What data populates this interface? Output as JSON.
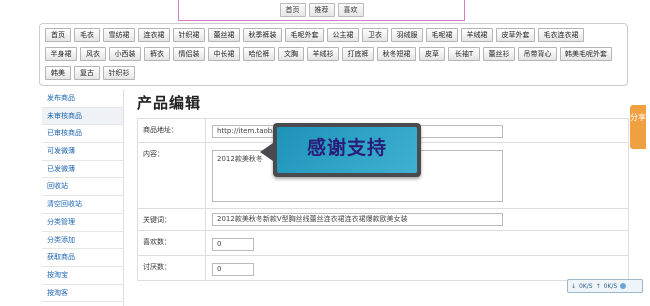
{
  "top_nav": {
    "items": [
      "首页",
      "推荐",
      "喜欢"
    ]
  },
  "categories": [
    "首页",
    "毛衣",
    "雪纺裙",
    "连衣裙",
    "针织裙",
    "蕾丝裙",
    "秋季裤装",
    "毛呢外套",
    "公主裙",
    "卫衣",
    "羽绒服",
    "毛呢裙",
    "羊绒裙",
    "皮草外套",
    "毛衣连衣裙",
    "半身裙",
    "风衣",
    "小西装",
    "裤衣",
    "情侣装",
    "中长裙",
    "哈伦裤",
    "文胸",
    "羊绒衫",
    "打底裤",
    "秋冬短裙",
    "皮草",
    "长袖T",
    "蕾丝衫",
    "吊带背心",
    "韩美毛呢外套",
    "韩美",
    "复古",
    "针织衫"
  ],
  "sidebar": {
    "items": [
      "发布商品",
      "未审核商品",
      "已审核商品",
      "可发微薄",
      "已发微薄",
      "回收站",
      "清空回收站",
      "分类管理",
      "分类添加",
      "获取商品",
      "按淘宝",
      "按淘客"
    ]
  },
  "page_title": "产品编辑",
  "form": {
    "url_label": "商品地址：",
    "url_value": "http://item.taobao.com/item.htm?id=1                              062.0.0",
    "content_label": "内容：",
    "content_value": "2012款美秋冬",
    "keyword_label": "关键词：",
    "keyword_value": "2012款美秋冬新款V型胸丝线蕾丝连衣裙连衣裙爆款欧美女装",
    "likes_label": "喜欢数：",
    "likes_value": "0",
    "dislikes_label": "讨厌数：",
    "dislikes_value": "0"
  },
  "banner": {
    "text": "感谢支持"
  },
  "share_tab": {
    "text": "分享"
  },
  "widget": {
    "down": "0K/S",
    "up": "0K/S"
  }
}
